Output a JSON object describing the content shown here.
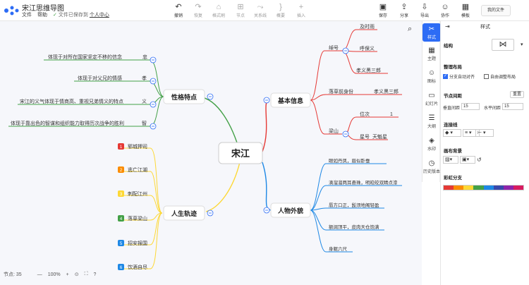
{
  "app": {
    "title": "宋江思维导图",
    "menus": [
      "文件",
      "帮助"
    ],
    "saved_text": "文件已保存到",
    "saved_link": "个人中心"
  },
  "toolbar": {
    "undo": "撤销",
    "redo": "恢复",
    "format_painter": "格式刷",
    "node": "节点",
    "relation": "关系线",
    "summary": "概要",
    "insert": "插入",
    "save": "保存",
    "share": "分享",
    "export": "导出",
    "collab": "协作",
    "template": "模板",
    "my_files": "我的文件"
  },
  "sidebar": {
    "style": "样式",
    "theme": "主题",
    "icon": "图标",
    "slideshow": "幻灯片",
    "outline": "大纲",
    "watermark": "水印",
    "history": "历史版本"
  },
  "panel": {
    "title": "样式",
    "structure_label": "结构",
    "layout_label": "整理布局",
    "auto_align": "分支自动对齐",
    "free_layout": "自由调整布局",
    "spacing_label": "节点间距",
    "reset": "重置",
    "v_spacing_label": "垂直间距",
    "v_spacing": "15",
    "h_spacing_label": "水平间距",
    "h_spacing": "15",
    "line_label": "连接线",
    "bg_label": "画布背景",
    "rainbow_label": "彩虹分支",
    "rainbow_colors": [
      "#e53935",
      "#fb8c00",
      "#fdd835",
      "#43a047",
      "#1e88e5",
      "#3949ab",
      "#8e24aa",
      "#d81b60"
    ]
  },
  "status": {
    "nodes_label": "节点:",
    "nodes": "35",
    "zoom": "100%"
  },
  "mindmap": {
    "root": "宋江",
    "branches": {
      "traits": {
        "label": "性格特点",
        "color": "#43a047"
      },
      "info": {
        "label": "基本信息",
        "color": "#e53935"
      },
      "path": {
        "label": "人生轨迹",
        "color": "#fdd835"
      },
      "look": {
        "label": "人物外貌",
        "color": "#1e88e5"
      }
    },
    "traits": [
      {
        "label": "体现于对所在国家坚定不移的信念",
        "tag": "忠"
      },
      {
        "label": "体现于对父兄的情感",
        "tag": "孝"
      },
      {
        "label": "宋江的义气体现于情商高、重视兄弟情义的特点",
        "tag": "义"
      },
      {
        "label": "体现于靠出色的智谋和组织能力取得历次战争的胜利",
        "tag": "智"
      }
    ],
    "info": {
      "nickname_label": "绰号",
      "nicknames": [
        "及时雨",
        "呼保义",
        "孝义黑三郎"
      ],
      "before_label": "落草前身份",
      "before": "孝义黑三郎",
      "liangshan_label": "梁山",
      "rank_label": "位次",
      "rank": "1",
      "star_label": "星号",
      "star": "天魁星"
    },
    "path": [
      "郓城押司",
      "逃亡江湖",
      "刺配江州",
      "落草梁山",
      "招安报国",
      "饮酒自尽"
    ],
    "look": [
      "眼如丹凤，眉似卧蚕",
      "滴溜溜两耳悬珠，明皎皎双睛点漆",
      "唇方口正，髭须地阁轻盈",
      "额阔顶平，皮肉天仓饱满",
      "身躯六尺"
    ]
  }
}
